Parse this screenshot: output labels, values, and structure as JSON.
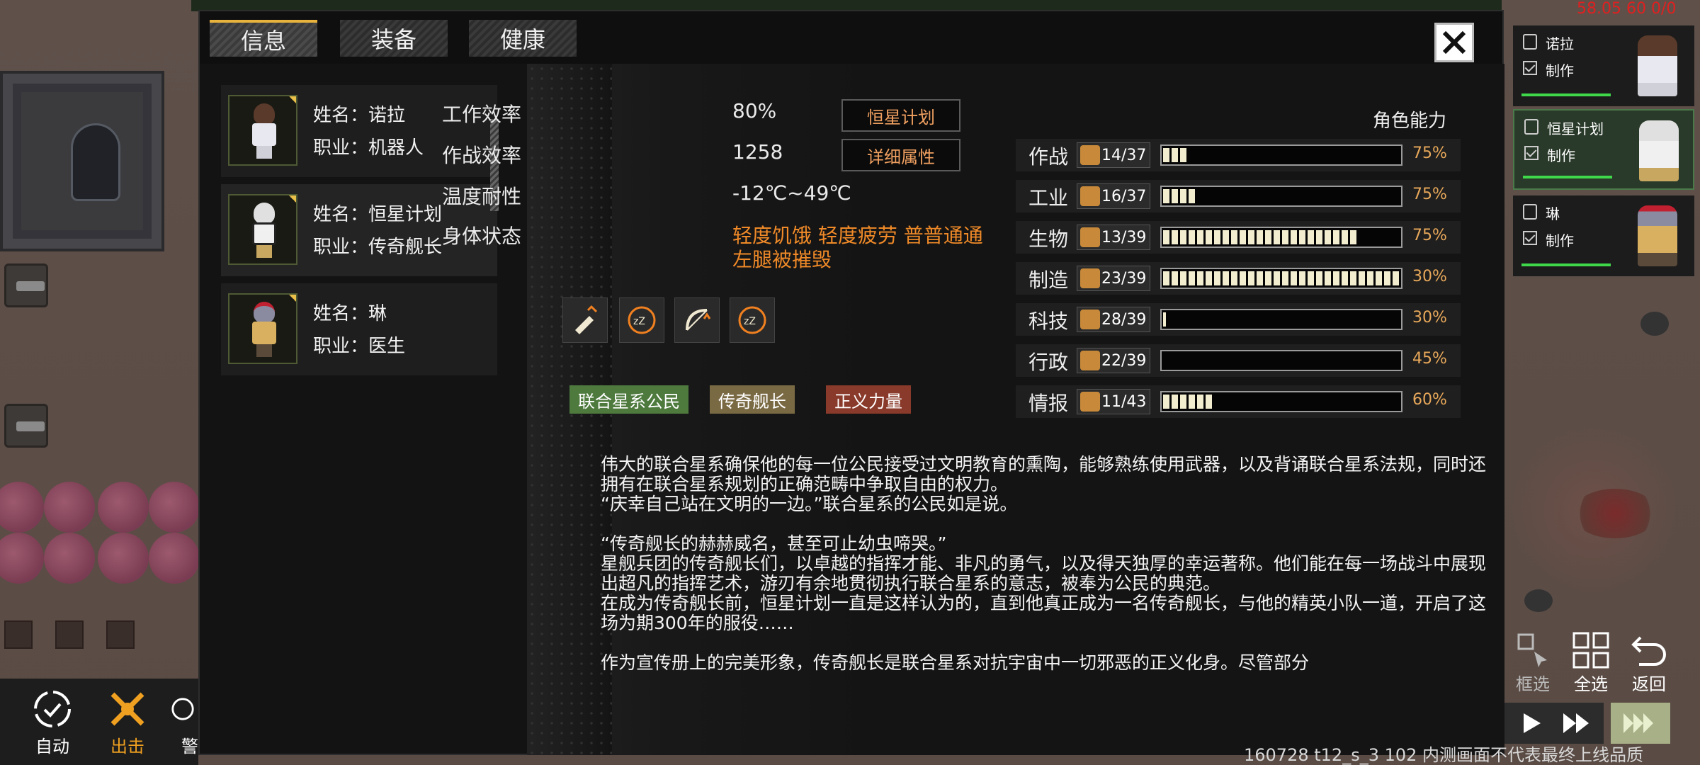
{
  "hud": {
    "fps": "58.05 60 0/0",
    "build_info": "160728 t12_s_3 102  内测画面不代表最终上线品质"
  },
  "tabs": [
    {
      "label": "信息"
    },
    {
      "label": "装备"
    },
    {
      "label": "健康"
    }
  ],
  "characters": [
    {
      "name": "姓名：诺拉",
      "job": "职业：机器人"
    },
    {
      "name": "姓名：恒星计划",
      "job": "职业：传奇舰长"
    },
    {
      "name": "姓名：琳",
      "job": "职业：医生"
    }
  ],
  "attributes": {
    "work_eff_label": "工作效率",
    "work_eff_value": "80%",
    "combat_eff_label": "作战效率",
    "combat_eff_value": "1258",
    "temp_label": "温度耐性",
    "temp_value": "-12℃~49℃",
    "body_label": "身体状态",
    "body_value": "轻度饥饿 轻度疲劳 普普通通 左腿被摧毁",
    "name_button": "恒星计划",
    "detail_button": "详细属性"
  },
  "status_icons": [
    "bullet-up-icon",
    "sleep-icon",
    "bow-up-icon",
    "sleep-icon"
  ],
  "traits": [
    {
      "label": "联合星系公民",
      "color": "#4e7a3e"
    },
    {
      "label": "传奇舰长",
      "color": "#7a6a44"
    },
    {
      "label": "正义力量",
      "color": "#8a3a2a"
    }
  ],
  "abilities": {
    "title": "角色能力",
    "rows": [
      {
        "label": "作战",
        "level": "14/37",
        "fill": 0.1,
        "pct": "75%"
      },
      {
        "label": "工业",
        "level": "16/37",
        "fill": 0.14,
        "pct": "75%"
      },
      {
        "label": "生物",
        "level": "13/39",
        "fill": 0.83,
        "pct": "75%"
      },
      {
        "label": "制造",
        "level": "23/39",
        "fill": 1.0,
        "pct": "30%"
      },
      {
        "label": "科技",
        "level": "28/39",
        "fill": 0.01,
        "pct": "30%"
      },
      {
        "label": "行政",
        "level": "22/39",
        "fill": 0.0,
        "pct": "45%"
      },
      {
        "label": "情报",
        "level": "11/43",
        "fill": 0.2,
        "pct": "60%"
      }
    ]
  },
  "description": {
    "p1": "伟大的联合星系确保他的每一位公民接受过文明教育的熏陶，能够熟练使用武器，以及背诵联合星系法规，同时还拥有在联合星系规划的正确范畴中争取自由的权力。",
    "p2": "“庆幸自己站在文明的一边。”联合星系的公民如是说。",
    "p3": "“传奇舰长的赫赫威名，甚至可止幼虫啼哭。”",
    "p4": "星舰兵团的传奇舰长们，以卓越的指挥才能、非凡的勇气，以及得天独厚的幸运著称。他们能在每一场战斗中展现出超凡的指挥艺术，游刃有余地贯彻执行联合星系的意志，被奉为公民的典范。",
    "p5": "在成为传奇舰长前，恒星计划一直是这样认为的，直到他真正成为一名传奇舰长，与他的精英小队一道，开启了这场为期300年的服役……",
    "p6": "作为宣传册上的完美形象，传奇舰长是联合星系对抗宇宙中一切邪恶的正义化身。尽管部分"
  },
  "queue": [
    {
      "name": "诺拉",
      "task": "制作"
    },
    {
      "name": "恒星计划",
      "task": "制作"
    },
    {
      "name": "琳",
      "task": "制作"
    }
  ],
  "controls": {
    "select_frame": "框选",
    "select_all": "全选",
    "back": "返回"
  },
  "bottom_left": {
    "auto": "自动",
    "sortie": "出击",
    "alert": "警"
  }
}
